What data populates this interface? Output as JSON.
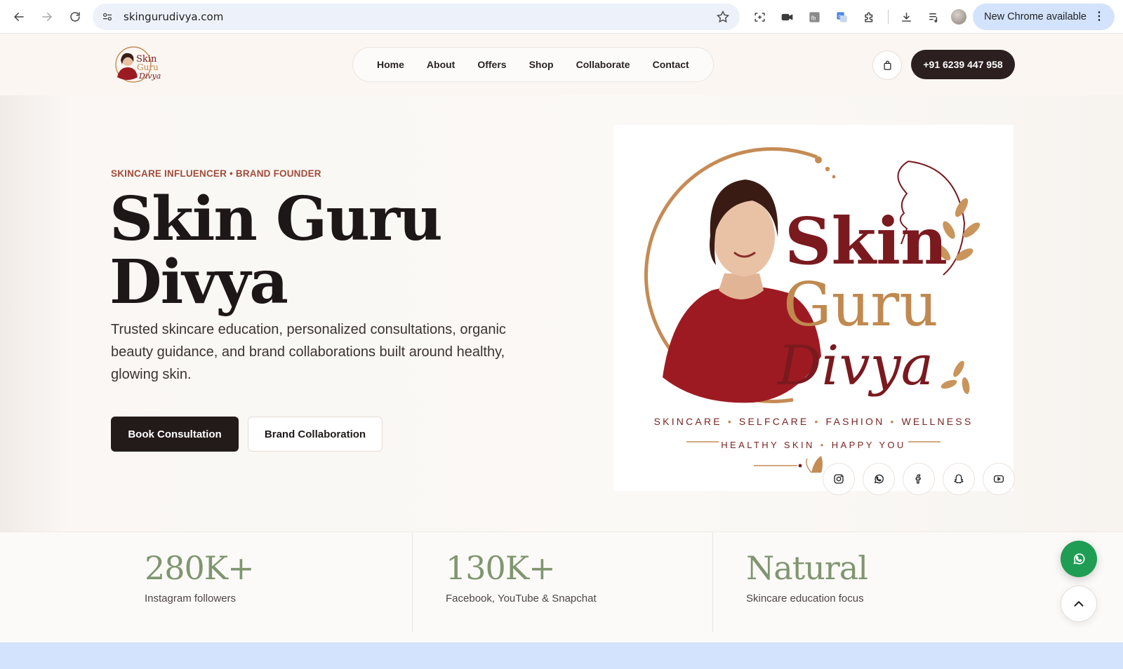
{
  "browser": {
    "url": "skingurudivya.com",
    "update_label": "New Chrome available",
    "update_menu": "⋮"
  },
  "header": {
    "logo_alt": "Skin Guru Divya",
    "nav": [
      "Home",
      "About",
      "Offers",
      "Shop",
      "Collaborate",
      "Contact"
    ],
    "phone": "+91 6239 447 958"
  },
  "hero": {
    "eyebrow": "SKINCARE INFLUENCER • BRAND FOUNDER",
    "title_line1": "Skin Guru",
    "title_line2": "Divya",
    "description": "Trusted skincare education, personalized consultations, organic beauty guidance, and brand collaborations built around healthy, glowing skin.",
    "primary_cta": "Book Consultation",
    "secondary_cta": "Brand Collaboration"
  },
  "brand_card": {
    "logo_word1": "Skin",
    "logo_word2": "Guru",
    "logo_word3": "Divya",
    "tags": [
      "SKINCARE",
      "SELFCARE",
      "FASHION",
      "WELLNESS"
    ],
    "sub_tags": [
      "HEALTHY SKIN",
      "HAPPY YOU"
    ],
    "colors": {
      "maroon": "#7a1a1f",
      "gold": "#c0894f"
    }
  },
  "socials": [
    "instagram-icon",
    "whatsapp-icon",
    "facebook-icon",
    "snapchat-icon",
    "youtube-icon"
  ],
  "stats": [
    {
      "value": "280K+",
      "label": "Instagram followers"
    },
    {
      "value": "130K+",
      "label": "Facebook, YouTube & Snapchat"
    },
    {
      "value": "Natural",
      "label": "Skincare education focus"
    }
  ]
}
